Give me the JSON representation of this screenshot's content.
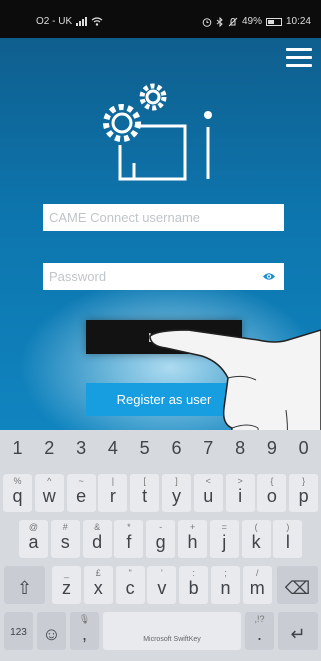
{
  "status_bar": {
    "carrier": "O2 - UK",
    "status_icons": [
      "alarm-icon",
      "bluetooth-icon",
      "mute-icon"
    ],
    "battery_percent_text": "49%",
    "battery_level": 0.49,
    "time": "10:24"
  },
  "login": {
    "username_placeholder": "CAME Connect username",
    "password_placeholder": "Password",
    "login_label": "Login",
    "register_label": "Register as user"
  },
  "colors": {
    "app_background": "#0d75ad",
    "register_button": "#169ee0",
    "login_button": "#121212",
    "eye_icon": "#1a8fd0"
  },
  "keyboard": {
    "name": "Microsoft SwiftKey",
    "number_row": [
      "1",
      "2",
      "3",
      "4",
      "5",
      "6",
      "7",
      "8",
      "9",
      "0"
    ],
    "row1": [
      {
        "main": "q",
        "alt": "%"
      },
      {
        "main": "w",
        "alt": "^"
      },
      {
        "main": "e",
        "alt": "~"
      },
      {
        "main": "r",
        "alt": "|"
      },
      {
        "main": "t",
        "alt": "["
      },
      {
        "main": "y",
        "alt": "]"
      },
      {
        "main": "u",
        "alt": "<"
      },
      {
        "main": "i",
        "alt": ">"
      },
      {
        "main": "o",
        "alt": "{"
      },
      {
        "main": "p",
        "alt": "}"
      }
    ],
    "row2": [
      {
        "main": "a",
        "alt": "@"
      },
      {
        "main": "s",
        "alt": "#"
      },
      {
        "main": "d",
        "alt": "&"
      },
      {
        "main": "f",
        "alt": "*"
      },
      {
        "main": "g",
        "alt": "-"
      },
      {
        "main": "h",
        "alt": "+"
      },
      {
        "main": "j",
        "alt": "="
      },
      {
        "main": "k",
        "alt": "("
      },
      {
        "main": "l",
        "alt": ")"
      }
    ],
    "row3": [
      {
        "main": "z",
        "alt": "_"
      },
      {
        "main": "x",
        "alt": "£"
      },
      {
        "main": "c",
        "alt": "\""
      },
      {
        "main": "v",
        "alt": "'"
      },
      {
        "main": "b",
        "alt": ":"
      },
      {
        "main": "n",
        "alt": ";"
      },
      {
        "main": "m",
        "alt": "/"
      }
    ],
    "shift_glyph": "⇧",
    "backspace_glyph": "⌫",
    "numbers_key": "123",
    "emoji_glyph": "☺",
    "comma": ",",
    "comma_alt": "🎙",
    "period": ".",
    "period_alt": ",!?",
    "enter_glyph": "↵"
  }
}
